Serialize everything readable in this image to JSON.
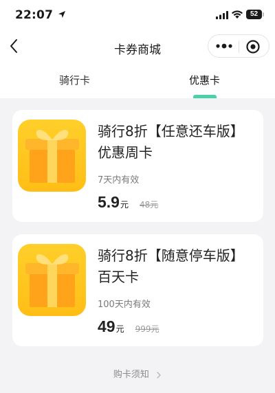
{
  "status_bar": {
    "time": "22:07",
    "battery": "52"
  },
  "nav": {
    "title": "卡券商城"
  },
  "tabs": [
    {
      "label": "骑行卡",
      "active": false
    },
    {
      "label": "优惠卡",
      "active": true
    }
  ],
  "cards": [
    {
      "title": "骑行8折【任意还车版】优惠周卡",
      "validity": "7天内有效",
      "price": "5.9",
      "unit": "元",
      "original_price": "48元"
    },
    {
      "title": "骑行8折【随意停车版】百天卡",
      "validity": "100天内有效",
      "price": "49",
      "unit": "元",
      "original_price": "999元"
    }
  ],
  "footer": {
    "link": "购卡须知"
  },
  "colors": {
    "accent": "#4cd0a9",
    "gift": "#ffbe16",
    "background": "#f3f3f5"
  }
}
